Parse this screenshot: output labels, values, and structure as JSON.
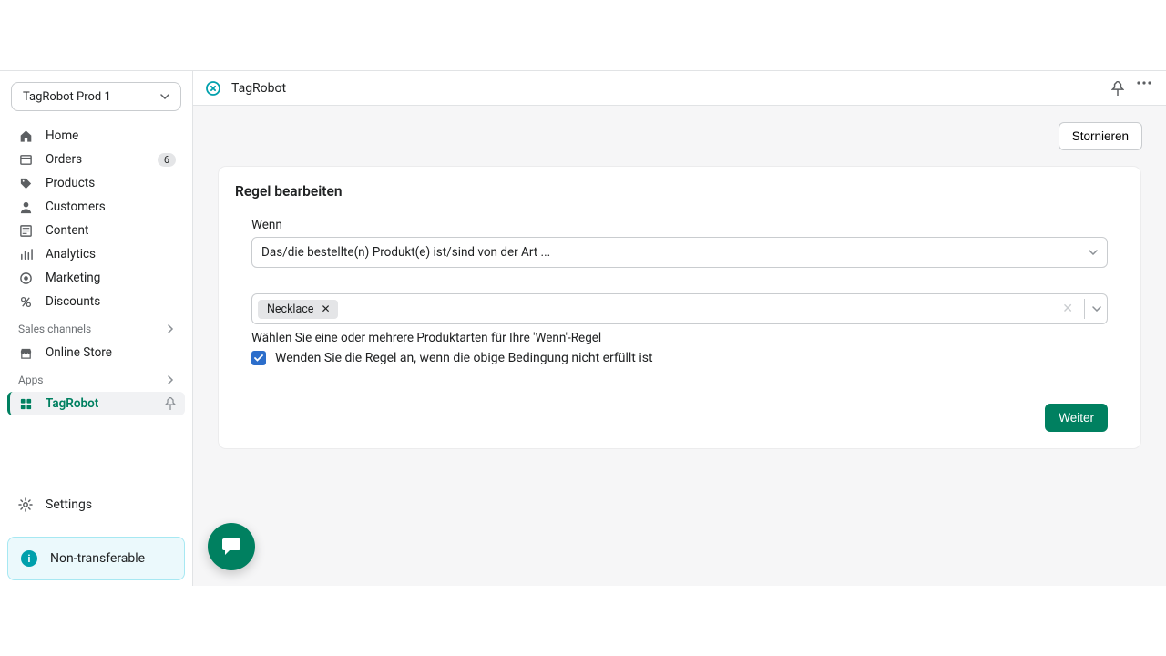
{
  "store_name": "TagRobot Prod 1",
  "nav": {
    "home": "Home",
    "orders": "Orders",
    "orders_count": "6",
    "products": "Products",
    "customers": "Customers",
    "content": "Content",
    "analytics": "Analytics",
    "marketing": "Marketing",
    "discounts": "Discounts"
  },
  "sections": {
    "sales_channels": "Sales channels",
    "online_store": "Online Store",
    "apps": "Apps",
    "tagrobot": "TagRobot"
  },
  "settings_label": "Settings",
  "banner_text": "Non-transferable",
  "app_header_title": "TagRobot",
  "cancel_label": "Stornieren",
  "card": {
    "title": "Regel bearbeiten",
    "when_label": "Wenn",
    "condition_value": "Das/die bestellte(n) Produkt(e) ist/sind von der Art ...",
    "tag_value": "Necklace",
    "hint": "Wählen Sie eine oder mehrere Produktarten für Ihre 'Wenn'-Regel",
    "invert_label": "Wenden Sie die Regel an, wenn die obige Bedingung nicht erfüllt ist",
    "next_label": "Weiter"
  }
}
